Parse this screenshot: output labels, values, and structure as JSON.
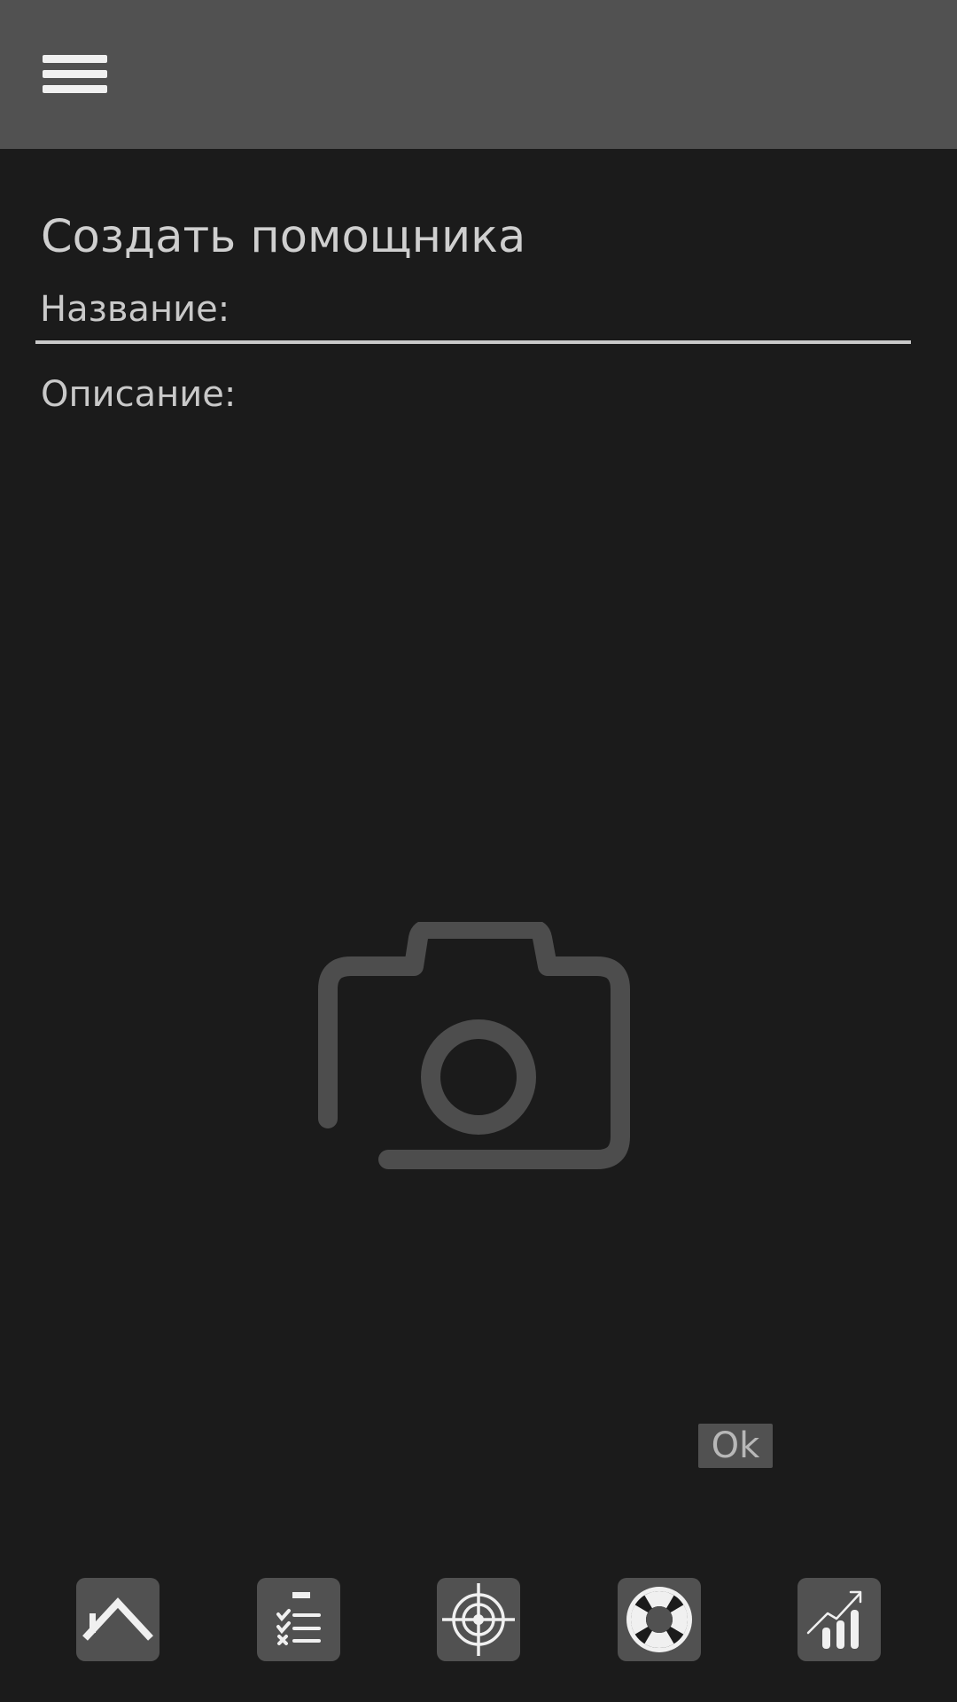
{
  "header": {
    "menu_icon": "hamburger-menu-icon"
  },
  "form": {
    "title": "Создать помощника",
    "name_label": "Название:",
    "name_value": "",
    "description_label": "Описание:",
    "description_value": "",
    "photo_icon": "camera-icon",
    "ok_label": "Ok"
  },
  "bottom_nav": {
    "items": [
      {
        "icon": "home-icon"
      },
      {
        "icon": "checklist-icon"
      },
      {
        "icon": "target-icon"
      },
      {
        "icon": "lifebuoy-icon"
      },
      {
        "icon": "growth-chart-icon"
      }
    ]
  },
  "colors": {
    "background": "#1b1b1b",
    "topbar": "#515151",
    "text": "#cfcfcf",
    "icon_fg": "#f0f0f0"
  }
}
